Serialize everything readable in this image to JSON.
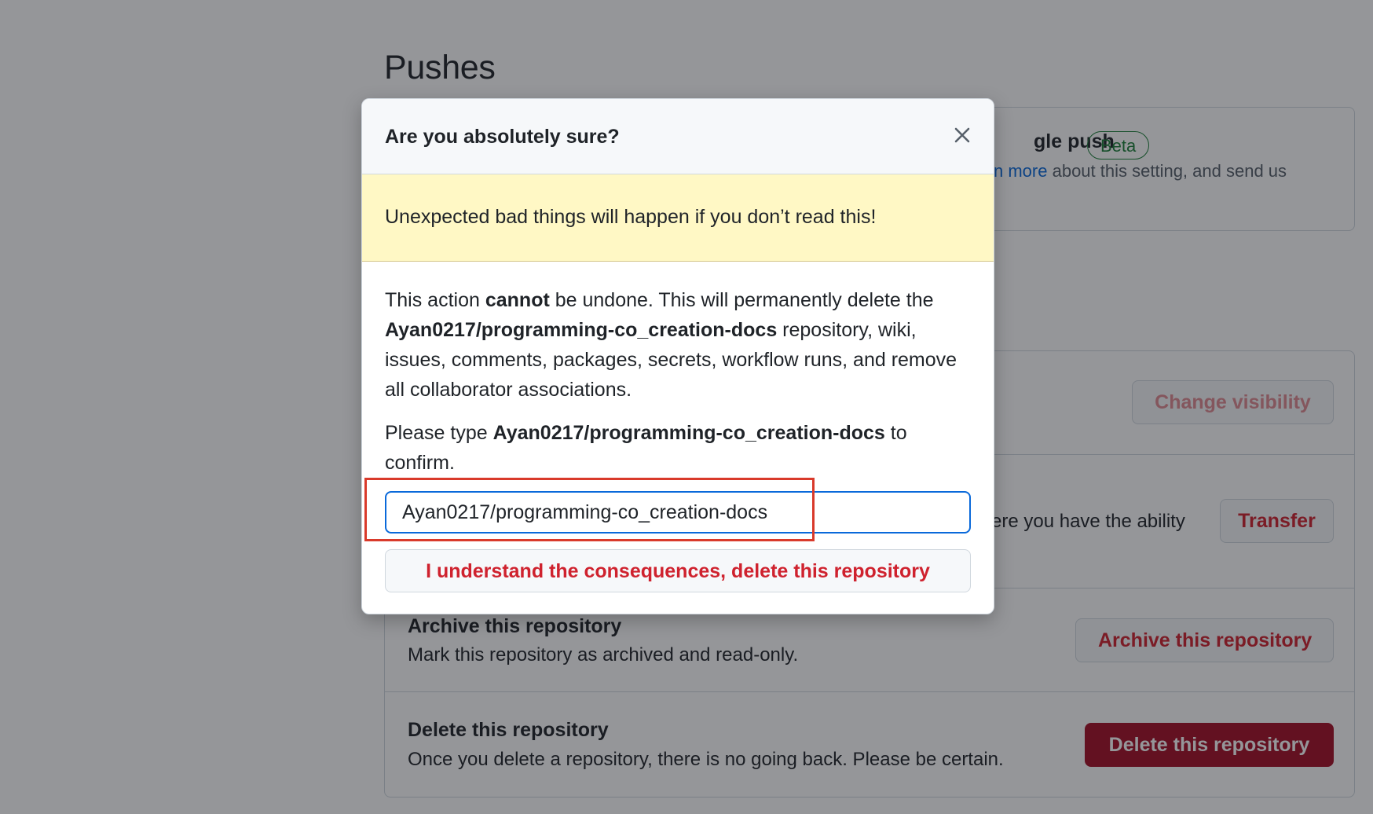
{
  "page": {
    "heading": "Pushes"
  },
  "push_setting": {
    "title_fragment": "gle push",
    "badge": "Beta",
    "link_fragment": "n more",
    "desc_fragment": " about this setting, and send us"
  },
  "danger_zone": {
    "visibility": {
      "button": "Change visibility"
    },
    "transfer": {
      "desc_fragment": "ere you have the ability",
      "button": "Transfer"
    },
    "archive": {
      "title": "Archive this repository",
      "desc": "Mark this repository as archived and read-only.",
      "button": "Archive this repository"
    },
    "delete": {
      "title": "Delete this repository",
      "desc": "Once you delete a repository, there is no going back. Please be certain.",
      "button": "Delete this repository"
    }
  },
  "modal": {
    "title": "Are you absolutely sure?",
    "warning": "Unexpected bad things will happen if you don’t read this!",
    "body": {
      "p1": "This action ",
      "bold1": "cannot",
      "p2": " be undone. This will permanently delete the ",
      "repo": "Ayan0217/programming-co_creation-docs",
      "p3": " repository, wiki, issues, comments, packages, secrets, workflow runs, and remove all collaborator associations."
    },
    "confirm": {
      "p1": "Please type ",
      "repo": "Ayan0217/programming-co_creation-docs",
      "p2": " to confirm."
    },
    "input_value": "Ayan0217/programming-co_creation-docs",
    "delete_button": "I understand the consequences, delete this repository"
  },
  "colors": {
    "danger": "#cf222e",
    "focus": "#0969da",
    "warning_bg": "#fff8c5",
    "annotation": "#d93a2b"
  },
  "icons": {
    "close": "close-icon"
  }
}
